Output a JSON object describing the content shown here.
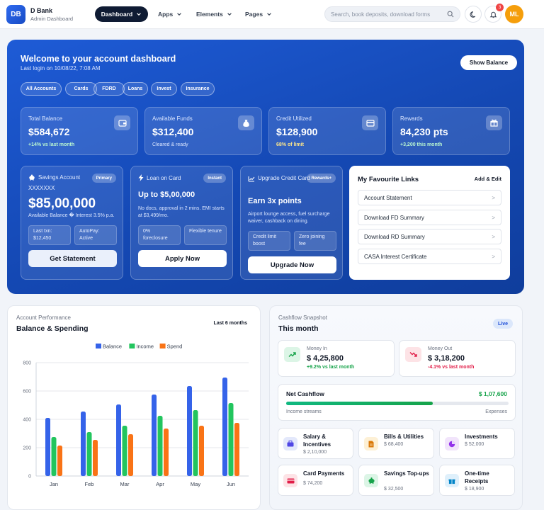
{
  "brand": {
    "initials": "DB",
    "name": "D Bank",
    "subtitle": "Admin Dashboard"
  },
  "nav": {
    "active": "Dashboard",
    "items": [
      "Apps",
      "Elements",
      "Pages"
    ]
  },
  "search": {
    "placeholder": "Search, book deposits, download forms"
  },
  "notifications": {
    "count": "3"
  },
  "user": {
    "initials": "ML"
  },
  "hero": {
    "title": "Welcome to your account dashboard",
    "last_login": "Last login on 10/08/22, 7:08 AM",
    "show_balance": "Show Balance",
    "chips": [
      "All Accounts",
      "Cards",
      "FDRD",
      "Loans",
      "Invest",
      "Insurance"
    ]
  },
  "stats": [
    {
      "label": "Total Balance",
      "value": "$584,672",
      "note": "+14% vs last month",
      "icon": "wallet-icon"
    },
    {
      "label": "Available Funds",
      "value": "$312,400",
      "note": "Cleared & ready",
      "icon": "money-bag-icon"
    },
    {
      "label": "Credit Utilized",
      "value": "$128,900",
      "note": "68% of limit",
      "icon": "credit-card-icon"
    },
    {
      "label": "Rewards",
      "value": "84,230 pts",
      "note": "+3,200 this month",
      "icon": "gift-icon"
    }
  ],
  "savings": {
    "title": "Savings Account",
    "tag": "Primary",
    "account": "XXXXXXX",
    "amount": "$85,00,000",
    "meta": "Available Balance � Interest 3.5% p.a.",
    "mini1": "Last txn: $12,450",
    "mini2": "AutoPay: Active",
    "button": "Get Statement"
  },
  "loan": {
    "title": "Loan on Card",
    "tag": "Instant",
    "headline": "Up to $5,00,000",
    "desc": "No docs, approval in 2 mins. EMI starts at $3,499/mo.",
    "mini1": "0% foreclosure",
    "mini2": "Flexible tenure",
    "button": "Apply Now"
  },
  "upgrade": {
    "title": "Upgrade Credit Card",
    "tag": "Rewards+",
    "headline": "Earn 3x points",
    "desc": "Airport lounge access, fuel surcharge waiver, cashback on dining.",
    "mini1": "Credit limit boost",
    "mini2": "Zero joining fee",
    "button": "Upgrade Now"
  },
  "favourites": {
    "title": "My Favourite Links",
    "action": "Add & Edit",
    "items": [
      "Account Statement",
      "Download FD Summary",
      "Download RD Summary",
      "CASA Interest Certificate"
    ],
    "arrow": ">"
  },
  "performance": {
    "subtitle": "Account Performance",
    "title": "Balance & Spending",
    "range": "Last 6 months"
  },
  "chart_data": {
    "type": "bar",
    "categories": [
      "Jan",
      "Feb",
      "Mar",
      "Apr",
      "May",
      "Jun"
    ],
    "series": [
      {
        "name": "Balance",
        "color": "#3563e9",
        "values": [
          410,
          455,
          505,
          575,
          635,
          695
        ]
      },
      {
        "name": "Income",
        "color": "#22c55e",
        "values": [
          275,
          310,
          355,
          425,
          465,
          515
        ]
      },
      {
        "name": "Spend",
        "color": "#f97316",
        "values": [
          215,
          255,
          295,
          335,
          355,
          375
        ]
      }
    ],
    "ylim": [
      0,
      800
    ],
    "yticks": [
      0,
      200,
      400,
      600,
      800
    ],
    "grid": true,
    "legend": "top-center"
  },
  "cashflow": {
    "subtitle": "Cashflow Snapshot",
    "title": "This month",
    "live": "Live",
    "money_in": {
      "label": "Money In",
      "value": "$ 4,25,800",
      "note": "+9.2% vs last month"
    },
    "money_out": {
      "label": "Money Out",
      "value": "$ 3,18,200",
      "note": "-4.1% vs last month"
    },
    "net": {
      "label": "Net Cashflow",
      "value": "$ 1,07,600",
      "left": "Income streams",
      "right": "Expenses",
      "progress": 0.66
    },
    "tiles": [
      {
        "name": "Salary & Incentives",
        "amount": "$ 2,10,000",
        "icon": "briefcase-icon",
        "bg": "#e3e8fb",
        "fg": "#4f46e5"
      },
      {
        "name": "Bills & Utilities",
        "amount": "$ 68,400",
        "icon": "document-icon",
        "bg": "#fdf0d5",
        "fg": "#d97706"
      },
      {
        "name": "Investments",
        "amount": "$ 52,000",
        "icon": "pie-chart-icon",
        "bg": "#f1e4fb",
        "fg": "#9333ea"
      },
      {
        "name": "Card Payments",
        "amount": "$ 74,200",
        "icon": "credit-card-icon",
        "bg": "#fde3e6",
        "fg": "#e11d48"
      },
      {
        "name": "Savings Top-ups",
        "amount": "$ 32,500",
        "icon": "piggy-bank-icon",
        "bg": "#dcf5e6",
        "fg": "#16a34a"
      },
      {
        "name": "One-time Receipts",
        "amount": "$ 18,900",
        "icon": "gift-icon",
        "bg": "#dff0fb",
        "fg": "#0284c7"
      }
    ]
  }
}
